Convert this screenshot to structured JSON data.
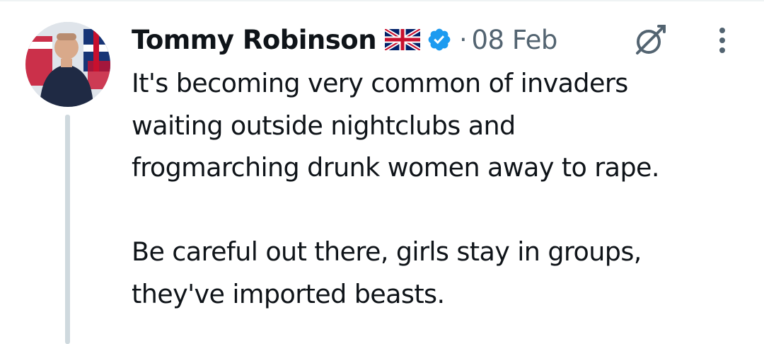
{
  "tweet": {
    "author": {
      "display_name": "Tommy Robinson",
      "flag_icon": "uk-flag-icon",
      "verified_icon": "verified-badge-icon",
      "verified_color": "#1d9bf0"
    },
    "separator": "·",
    "timestamp": "08 Feb",
    "actions": {
      "grok_icon": "grok-icon",
      "more_icon": "more-options-icon"
    },
    "text_paragraphs": [
      "It's becoming very common of invaders\nwaiting outside nightclubs and\nfrogmarching drunk women away to rape.",
      "Be careful out there, girls stay in groups,\nthey've imported beasts."
    ]
  },
  "colors": {
    "text_primary": "#0f1419",
    "text_secondary": "#536471",
    "thread_line": "#cfd9de"
  }
}
